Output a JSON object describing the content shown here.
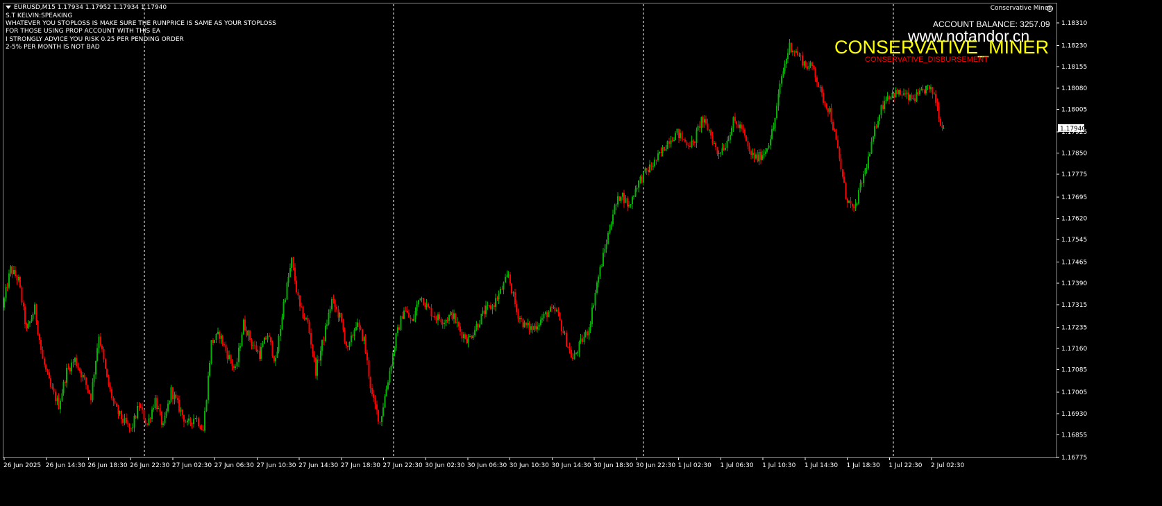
{
  "header": {
    "symbol": "EURUSD,M15  1.17934 1.17952 1.17934 1.17940"
  },
  "notes": [
    "S.T KELVIN:SPEAKING",
    "WHATEVER YOU STOPLOSS IS MAKE SURE THE RUNPRICE IS SAME AS YOUR STOPLOSS",
    "FOR THOSE USING PROP ACCOUNT WITH THIS EA",
    "I STRONGLY ADVICE YOU RISK 0.25 PER PENDING ORDER",
    "2-5% PER MONTH IS NOT BAD"
  ],
  "ea": {
    "name": "Conservative Miner",
    "icon": "smiley-icon"
  },
  "overlay": {
    "balance": "ACCOUNT BALANCE: 3257.09",
    "website": "www.notandor.cn",
    "brand": "CONSERVATIVE_MINER",
    "subbrand": "CONSERVATIVE_DISBURSEMENT"
  },
  "colors": {
    "bull": "#00b400",
    "bear": "#ff0000",
    "background": "#000000",
    "text": "#ffffff",
    "brand": "#ffff00",
    "frame": "#8a8a8a"
  },
  "chart_data": {
    "type": "candlestick",
    "title": "",
    "current_price": "1.17940",
    "ylim": [
      1.16775,
      1.1831
    ],
    "y_ticks": [
      "1.18310",
      "1.18230",
      "1.18155",
      "1.18080",
      "1.18005",
      "1.17925",
      "1.17850",
      "1.17775",
      "1.17695",
      "1.17620",
      "1.17545",
      "1.17465",
      "1.17390",
      "1.17315",
      "1.17235",
      "1.17160",
      "1.17085",
      "1.17005",
      "1.16930",
      "1.16855",
      "1.16775"
    ],
    "x_ticks": [
      "26 Jun 2025",
      "26 Jun 14:30",
      "26 Jun 18:30",
      "26 Jun 22:30",
      "27 Jun 02:30",
      "27 Jun 06:30",
      "27 Jun 10:30",
      "27 Jun 14:30",
      "27 Jun 18:30",
      "27 Jun 22:30",
      "30 Jun 02:30",
      "30 Jun 06:30",
      "30 Jun 10:30",
      "30 Jun 14:30",
      "30 Jun 18:30",
      "30 Jun 22:30",
      "1 Jul 02:30",
      "1 Jul 06:30",
      "1 Jul 10:30",
      "1 Jul 14:30",
      "1 Jul 18:30",
      "1 Jul 22:30",
      "2 Jul 02:30"
    ],
    "session_separators": [
      13.5,
      49.5,
      85.5,
      121.5
    ],
    "grid": false,
    "series": [
      {
        "values": [
          [
            0,
            1.17305
          ],
          [
            1,
            1.1744
          ],
          [
            2,
            1.174
          ],
          [
            3,
            1.1722
          ],
          [
            4,
            1.173
          ],
          [
            5,
            1.1712
          ],
          [
            6,
            1.1702
          ],
          [
            7,
            1.1696
          ],
          [
            8,
            1.1708
          ],
          [
            9,
            1.1712
          ],
          [
            10,
            1.1706
          ],
          [
            11,
            1.1699
          ],
          [
            12,
            1.1721
          ],
          [
            13,
            1.1705
          ],
          [
            14,
            1.1695
          ],
          [
            15,
            1.16905
          ],
          [
            16,
            1.1687
          ],
          [
            17,
            1.1696
          ],
          [
            18,
            1.1689
          ],
          [
            19,
            1.1698
          ],
          [
            20,
            1.1688
          ],
          [
            21,
            1.1701
          ],
          [
            22,
            1.1695
          ],
          [
            23,
            1.1689
          ],
          [
            24,
            1.1692
          ],
          [
            25,
            1.1687
          ],
          [
            26,
            1.1718
          ],
          [
            27,
            1.1721
          ],
          [
            28,
            1.1714
          ],
          [
            29,
            1.1708
          ],
          [
            30,
            1.1725
          ],
          [
            31,
            1.1718
          ],
          [
            32,
            1.1714
          ],
          [
            33,
            1.1721
          ],
          [
            34,
            1.1711
          ],
          [
            35,
            1.1732
          ],
          [
            36,
            1.1747
          ],
          [
            37,
            1.173
          ],
          [
            38,
            1.1725
          ],
          [
            39,
            1.1708
          ],
          [
            40,
            1.172
          ],
          [
            41,
            1.1733
          ],
          [
            42,
            1.1727
          ],
          [
            43,
            1.1715
          ],
          [
            44,
            1.1725
          ],
          [
            45,
            1.1719
          ],
          [
            46,
            1.1699
          ],
          [
            47,
            1.169
          ],
          [
            48,
            1.1705
          ],
          [
            49,
            1.172
          ],
          [
            50,
            1.173
          ],
          [
            51,
            1.1725
          ],
          [
            52,
            1.1735
          ],
          [
            53,
            1.173
          ],
          [
            54,
            1.1727
          ],
          [
            55,
            1.1726
          ],
          [
            56,
            1.1728
          ],
          [
            57,
            1.1722
          ],
          [
            58,
            1.1719
          ],
          [
            59,
            1.1724
          ],
          [
            60,
            1.1729
          ],
          [
            61,
            1.1731
          ],
          [
            62,
            1.1736
          ],
          [
            63,
            1.1742
          ],
          [
            64,
            1.1729
          ],
          [
            65,
            1.1724
          ],
          [
            66,
            1.1723
          ],
          [
            67,
            1.1726
          ],
          [
            68,
            1.1729
          ],
          [
            69,
            1.1729
          ],
          [
            70,
            1.172
          ],
          [
            71,
            1.1712
          ],
          [
            72,
            1.1718
          ],
          [
            73,
            1.1723
          ],
          [
            74,
            1.1739
          ],
          [
            75,
            1.1751
          ],
          [
            76,
            1.1764
          ],
          [
            77,
            1.1771
          ],
          [
            78,
            1.1766
          ],
          [
            79,
            1.1774
          ],
          [
            80,
            1.1778
          ],
          [
            81,
            1.1781
          ],
          [
            82,
            1.1785
          ],
          [
            83,
            1.179
          ],
          [
            84,
            1.1792
          ],
          [
            85,
            1.1789
          ],
          [
            86,
            1.1788
          ],
          [
            87,
            1.1797
          ],
          [
            88,
            1.1793
          ],
          [
            89,
            1.1785
          ],
          [
            90,
            1.1788
          ],
          [
            91,
            1.1796
          ],
          [
            92,
            1.1794
          ],
          [
            93,
            1.1785
          ],
          [
            94,
            1.1783
          ],
          [
            95,
            1.1786
          ],
          [
            96,
            1.1794
          ],
          [
            97,
            1.1812
          ],
          [
            98,
            1.1823
          ],
          [
            99,
            1.182
          ],
          [
            100,
            1.1816
          ],
          [
            101,
            1.1815
          ],
          [
            102,
            1.1805
          ],
          [
            103,
            1.18
          ],
          [
            104,
            1.1786
          ],
          [
            105,
            1.177
          ],
          [
            106,
            1.1764
          ],
          [
            107,
            1.1775
          ],
          [
            108,
            1.1785
          ],
          [
            109,
            1.1798
          ],
          [
            110,
            1.1805
          ],
          [
            111,
            1.1806
          ],
          [
            112,
            1.1806
          ],
          [
            113,
            1.1804
          ],
          [
            114,
            1.1805
          ],
          [
            115,
            1.1808
          ],
          [
            116,
            1.1806
          ],
          [
            117,
            1.1794
          ]
        ]
      }
    ]
  }
}
